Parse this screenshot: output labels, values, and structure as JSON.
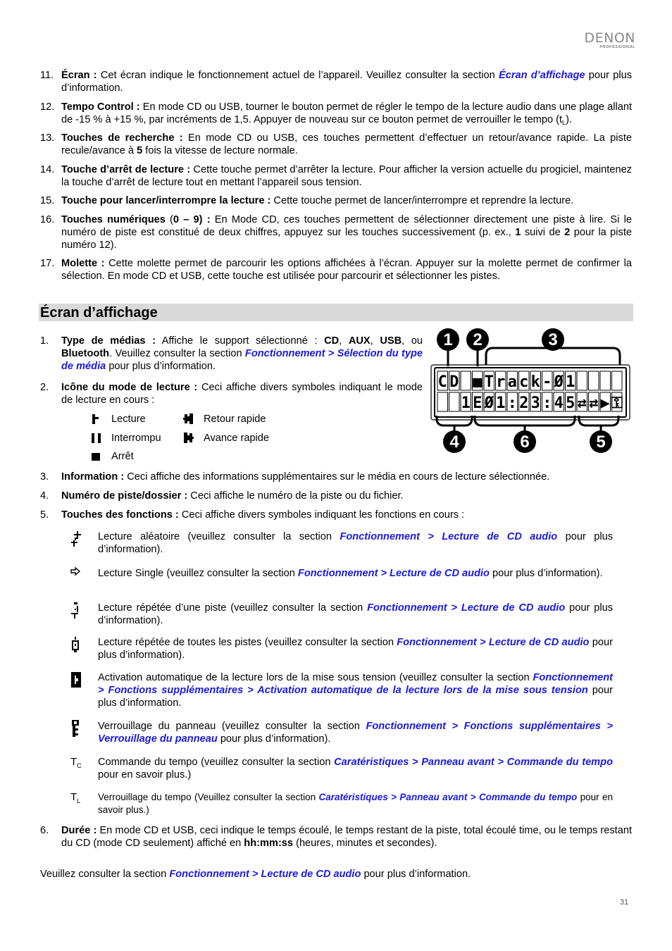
{
  "header": {
    "brand": "DENON",
    "brand_sub": "PROFESSIONAL"
  },
  "top_list": [
    {
      "num": "11.",
      "term": "Écran :",
      "text_before": " Cet écran indique le fonctionnement actuel de l’appareil. Veuillez consulter la section ",
      "link": "Écran d’affichage",
      "text_after": " pour plus d’information."
    },
    {
      "num": "12.",
      "term": "Tempo Control :",
      "text": " En mode CD ou USB, tourner le bouton permet de régler le tempo de la lecture audio dans une plage allant de -15 % à +15 %, par incréments de 1,5. Appuyer de nouveau sur ce bouton permet de verrouiller le tempo (t",
      "sub": "L",
      "text_end": ")."
    },
    {
      "num": "13.",
      "term": "Touches de recherche :",
      "text_before": " En mode CD ou USB, ces touches permettent d’effectuer un retour/avance rapide. La piste recule/avance à ",
      "bold": "5",
      "text_after": " fois la vitesse de lecture normale."
    },
    {
      "num": "14.",
      "term": "Touche d’arrêt de lecture :",
      "text": " Cette touche permet d’arrêter la lecture. Pour afficher la version actuelle du progiciel, maintenez la touche d’arrêt de lecture tout en mettant l’appareil sous tension."
    },
    {
      "num": "15.",
      "term": "Touche pour lancer/interrompre la lecture :",
      "text": " Cette touche permet de lancer/interrompre et reprendre la lecture."
    },
    {
      "num": "16.",
      "term": "Touches numériques",
      "term_paren_open": " (",
      "term_range": "0 – 9",
      "term_paren_close": ") :",
      "text_before": " En Mode CD, ces touches permettent de sélectionner directement une piste à lire. Si le numéro de piste est constitué de deux chiffres, appuyez sur les touches successivement (p. ex., ",
      "bold1": "1",
      "mid": " suivi de ",
      "bold2": "2",
      "text_after": " pour la piste numéro 12)."
    },
    {
      "num": "17.",
      "term": "Molette :",
      "text": " Cette molette permet de parcourir les options affichées à l’écran. Appuyer sur la molette permet de confirmer la sélection. En mode CD et USB, cette touche est utilisée pour parcourir et sélectionner les pistes."
    }
  ],
  "section": {
    "title": "Écran d’affichage"
  },
  "display_items": {
    "item1": {
      "num": "1.",
      "term": "Type de médias :",
      "t1": " Affiche le support sélectionné : ",
      "cd": "CD",
      "c1": ", ",
      "aux": "AUX",
      "c2": ", ",
      "usb": "USB",
      "c3": ", ou ",
      "bt": "Bluetooth",
      "t2": ". Veuillez consulter la section ",
      "link": "Fonctionnement > Sélection du type de média",
      "t3": " pour plus d’information."
    },
    "item2": {
      "num": "2.",
      "term": "Icône du mode de lecture :",
      "text": " Ceci affiche divers symboles indiquant le mode de lecture en cours :"
    },
    "modes": [
      {
        "icon": "play-icon",
        "label": "Lecture"
      },
      {
        "icon": "pause-icon",
        "label": "Interrompu"
      },
      {
        "icon": "stop-icon",
        "label": "Arrêt"
      },
      {
        "icon": "rewind-icon",
        "label": "Retour rapide"
      },
      {
        "icon": "fast-forward-icon",
        "label": "Avance rapide"
      }
    ],
    "item3": {
      "num": "3.",
      "term": "Information :",
      "text": " Ceci affiche des informations supplémentaires sur le média en cours de lecture sélectionnée."
    },
    "item4": {
      "num": "4.",
      "term": "Numéro de piste/dossier :",
      "text": " Ceci affiche le numéro de la piste ou du fichier."
    },
    "item5": {
      "num": "5.",
      "term": "Touches des fonctions :",
      "text": " Ceci affiche divers symboles indiquant les fonctions en cours :"
    },
    "functions": [
      {
        "icon": "shuffle-icon",
        "t1": "Lecture aléatoire (veuillez consulter la section ",
        "link": "Fonctionnement > Lecture de CD audio",
        "t2": " pour plus d’information)."
      },
      {
        "icon": "single-play-arrow-icon",
        "t1": "Lecture Single (veuillez consulter la section ",
        "link": "Fonctionnement > Lecture de CD audio",
        "t2": " pour plus d’information)."
      },
      {
        "icon": "repeat-one-icon",
        "t1": "Lecture répétée d’une piste (veuillez consulter la section ",
        "link": "Fonctionnement > Lecture de CD audio",
        "t2": " pour plus d’information)."
      },
      {
        "icon": "repeat-all-icon",
        "t1": "Lecture répétée de toutes les pistes (veuillez consulter la section ",
        "link": "Fonctionnement > Lecture de CD audio",
        "t2": " pour plus d’information)."
      },
      {
        "icon": "auto-play-icon",
        "t1": "Activation automatique de la lecture lors de la mise sous tension (veuillez consulter la section ",
        "link": "Fonctionnement > Fonctions supplémentaires > Activation automatique de la lecture lors de la mise sous tension",
        "t2": " pour plus d’information."
      },
      {
        "icon": "panel-lock-icon",
        "t1": "Verrouillage du panneau (veuillez consulter la section ",
        "link": "Fonctionnement > Fonctions supplémentaires > Verrouillage du panneau",
        "t2": " pour plus d’information)."
      },
      {
        "icon": "tempo-control-icon",
        "sym": "T",
        "sym_sub": "C",
        "t1": "Commande du tempo (veuillez consulter la section ",
        "link": "Caratéristiques > Panneau avant > Commande du tempo",
        "t2": " pour en savoir plus.)"
      },
      {
        "icon": "tempo-lock-icon",
        "sym": "T",
        "sym_sub": "L",
        "t1": "Verrouillage du tempo (Veuillez consulter la section ",
        "link": "Caratéristiques > Panneau avant > Commande du tempo",
        "t2": " pour en savoir plus.)"
      }
    ],
    "item6": {
      "num": "6.",
      "term": "Durée :",
      "t1": " En mode CD et USB, ceci indique le temps écoulé, le temps restant de la piste, total écoulé time, ou le temps restant du CD (mode CD seulement) affiché en ",
      "bold": "hh:mm:ss",
      "t2": " (heures, minutes et secondes)."
    }
  },
  "lcd": {
    "row1": [
      "C",
      "D",
      " ",
      "■",
      "T",
      "r",
      "a",
      "c",
      "k",
      "-",
      "Ø",
      "1",
      " ",
      " ",
      " ",
      " "
    ],
    "row2": [
      " ",
      " ",
      "1",
      "E",
      "Ø",
      "1",
      ":",
      "2",
      "3",
      ":",
      "4",
      "5",
      "⇄",
      "⇄",
      "▶",
      "🔒"
    ],
    "callouts": [
      "1",
      "2",
      "3",
      "4",
      "6",
      "5"
    ]
  },
  "footer": {
    "t1": "Veuillez consulter la section ",
    "link": "Fonctionnement > Lecture de CD audio",
    "t2": " pour plus d’information.",
    "page_number": "31"
  },
  "colors": {
    "link": "#1a1adf",
    "section_bar": "#d9d9d9",
    "brand": "#8a8a8a"
  }
}
